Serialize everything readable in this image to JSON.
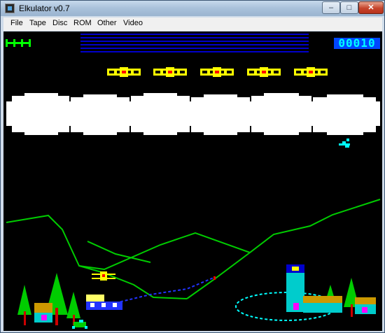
{
  "window": {
    "title": "Elkulator v0.7",
    "controls": {
      "minimize": "–",
      "maximize": "□",
      "close": "✕"
    }
  },
  "menu": {
    "items": [
      {
        "id": "file",
        "label": "File"
      },
      {
        "id": "tape",
        "label": "Tape"
      },
      {
        "id": "disc",
        "label": "Disc"
      },
      {
        "id": "rom",
        "label": "ROM"
      },
      {
        "id": "other",
        "label": "Other"
      },
      {
        "id": "video",
        "label": "Video"
      }
    ]
  },
  "game": {
    "score": "00010",
    "lives_icon": "plane-lives-icon",
    "enemy_planes_count": 5,
    "colors": {
      "background": "#000000",
      "hills": "#00cc00",
      "enemy_plane": "#ffff00",
      "cloud": "#ffffff",
      "player_jet": "#00ffff",
      "lake": "#00ffff",
      "stripes": "#0000cc",
      "score_bg": "#0047ff",
      "score_text": "#00ffff"
    }
  }
}
